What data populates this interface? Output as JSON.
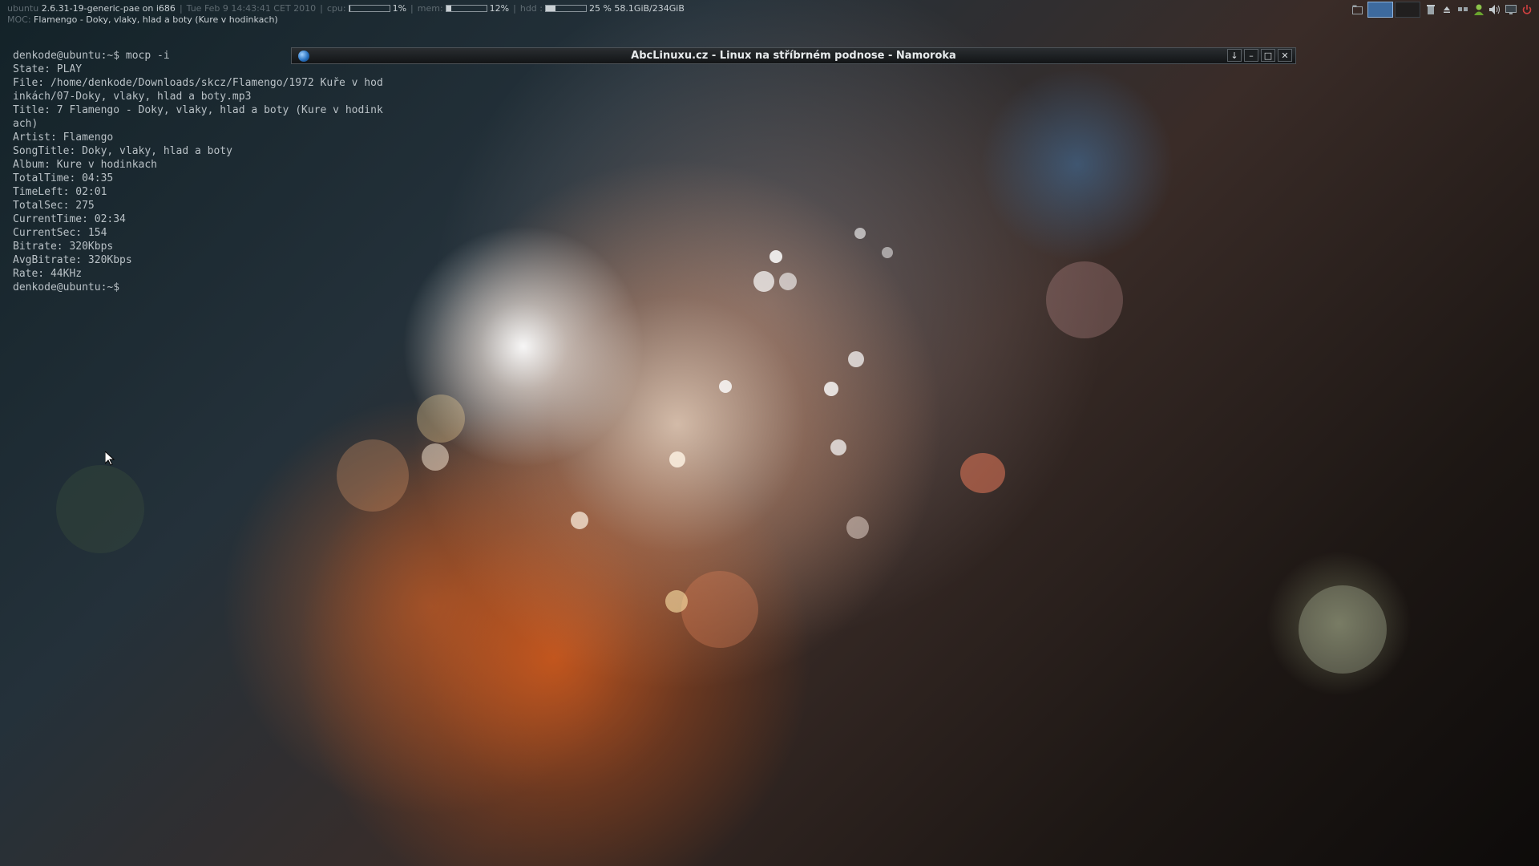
{
  "statusbar": {
    "host": "ubuntu",
    "kernel": "2.6.31-19-generic-pae on i686",
    "datetime": "Tue Feb  9 14:43:41 CET 2010",
    "cpu_label": "cpu:",
    "cpu_value": "1%",
    "cpu_fraction": 0.01,
    "mem_label": "mem:",
    "mem_value": "12%",
    "mem_fraction": 0.12,
    "hdd_label": "hdd :",
    "hdd_value": "25 % 58.1GiB/234GiB",
    "hdd_fraction": 0.25,
    "moc_label": "MOC:",
    "moc_track": "Flamengo - Doky, vlaky, hlad a boty (Kure v hodinkach)"
  },
  "window": {
    "title": "AbcLinuxu.cz - Linux na stříbrném podnose - Namoroka",
    "buttons": {
      "shade": "↓",
      "minimize": "–",
      "maximize": "□",
      "close": "✕"
    }
  },
  "terminal": {
    "lines": [
      "denkode@ubuntu:~$ mocp -i",
      "State: PLAY",
      "File: /home/denkode/Downloads/skcz/Flamengo/1972 Kuře v hod",
      "inkách/07-Doky, vlaky, hlad a boty.mp3",
      "Title: 7 Flamengo - Doky, vlaky, hlad a boty (Kure v hodink",
      "ach)",
      "Artist: Flamengo",
      "SongTitle: Doky, vlaky, hlad a boty",
      "Album: Kure v hodinkach",
      "TotalTime: 04:35",
      "TimeLeft: 02:01",
      "TotalSec: 275",
      "CurrentTime: 02:34",
      "CurrentSec: 154",
      "Bitrate: 320Kbps",
      "AvgBitrate: 320Kbps",
      "Rate: 44KHz",
      "denkode@ubuntu:~$"
    ]
  },
  "tray": {
    "icons": [
      "file-manager-icon",
      "trash-icon",
      "eject-icon",
      "network-icon",
      "user-status-icon",
      "volume-icon",
      "monitor-icon",
      "power-icon"
    ]
  }
}
